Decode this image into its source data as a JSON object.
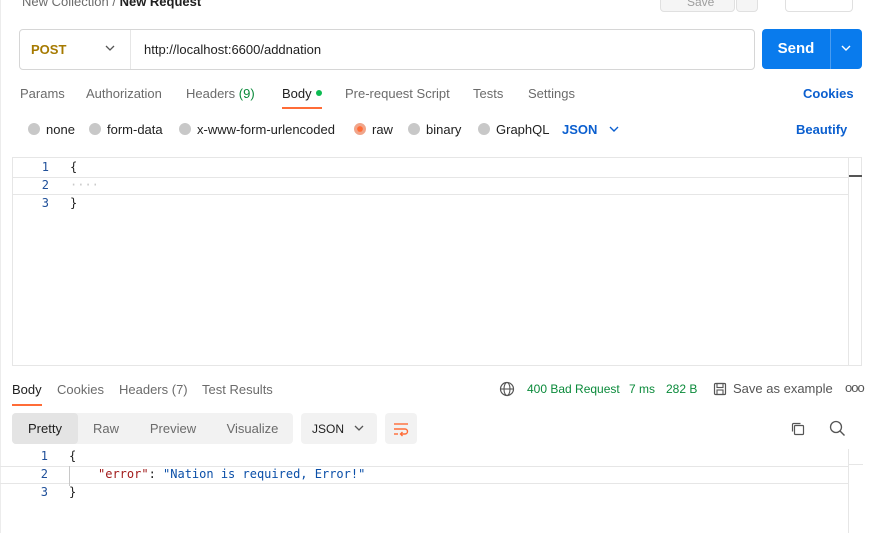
{
  "header": {
    "breadcrumb_collection": "New Collection",
    "breadcrumb_sep": "/",
    "breadcrumb_request": "New Request",
    "save_label": "Save"
  },
  "request": {
    "method": "POST",
    "url": "http://localhost:6600/addnation",
    "send_label": "Send"
  },
  "request_tabs": {
    "params": "Params",
    "authorization": "Authorization",
    "headers": "Headers",
    "headers_count": "(9)",
    "body": "Body",
    "pre_request": "Pre-request Script",
    "tests": "Tests",
    "settings": "Settings",
    "cookies": "Cookies"
  },
  "body_types": {
    "none": "none",
    "form_data": "form-data",
    "urlencoded": "x-www-form-urlencoded",
    "raw": "raw",
    "binary": "binary",
    "graphql": "GraphQL",
    "selected": "raw",
    "language": "JSON",
    "beautify": "Beautify"
  },
  "request_body": {
    "lines": [
      {
        "n": "1",
        "text": "{"
      },
      {
        "n": "2",
        "text": "····"
      },
      {
        "n": "3",
        "text": "}"
      }
    ]
  },
  "response_tabs": {
    "body": "Body",
    "cookies": "Cookies",
    "headers": "Headers (7)",
    "test_results": "Test Results"
  },
  "response_meta": {
    "status": "400 Bad Request",
    "time": "7 ms",
    "size": "282 B",
    "save_example": "Save as example",
    "more": "ooo",
    "status_color": "#0a8a3a"
  },
  "response_view": {
    "pretty": "Pretty",
    "raw": "Raw",
    "preview": "Preview",
    "visualize": "Visualize",
    "format": "JSON"
  },
  "response_body": {
    "line1_n": "1",
    "line1": "{",
    "line2_n": "2",
    "line2_key": "\"error\"",
    "line2_colon": ": ",
    "line2_value": "\"Nation is required, Error!\"",
    "line3_n": "3",
    "line3": "}"
  },
  "colors": {
    "accent": "#ff6c37",
    "send": "#097bed",
    "link": "#0b5fcf",
    "method_post": "#a67a00"
  }
}
